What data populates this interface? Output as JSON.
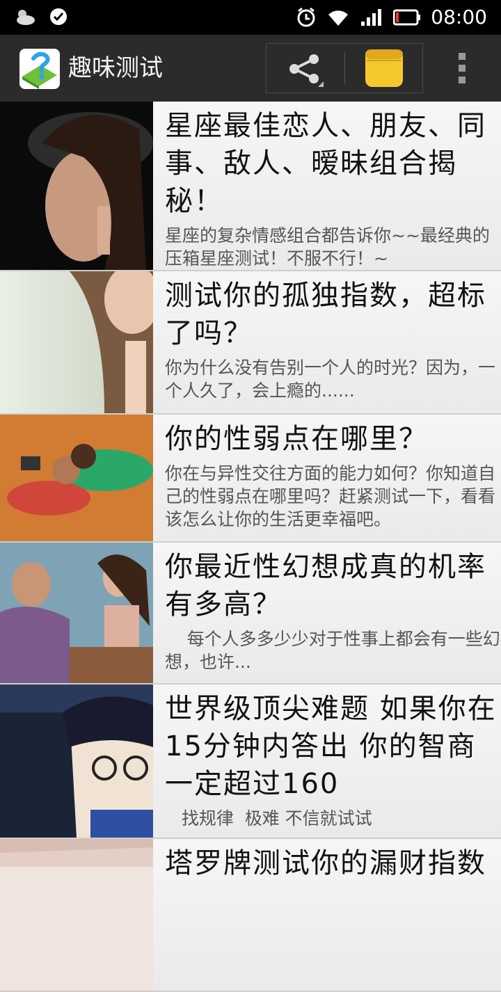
{
  "status_bar": {
    "time": "08:00",
    "icons": [
      "weather-cloud-icon",
      "check-circle-icon",
      "alarm-icon",
      "wifi-icon",
      "signal-icon",
      "battery-icon"
    ]
  },
  "action_bar": {
    "title": "趣味测试",
    "actions": [
      "share-icon",
      "notes-icon",
      "overflow-menu-icon"
    ],
    "accent_colors": {
      "logo_green": "#6fbf3b",
      "logo_blue": "#2fa3e6",
      "notes_yellow": "#f5c82b"
    }
  },
  "list": {
    "items": [
      {
        "title": "星座最佳恋人、朋友、同事、敌人、暧昧组合揭秘！",
        "desc": "星座的复杂情感组合都告诉你~~最经典的压箱星座测试！不服不行！~"
      },
      {
        "title": "测试你的孤独指数，超标了吗？",
        "desc": "你为什么没有告别一个人的时光？因为，一个人久了，会上瘾的......"
      },
      {
        "title": "你的性弱点在哪里？",
        "desc": "你在与异性交往方面的能力如何？你知道自己的性弱点在哪里吗？赶紧测试一下，看看该怎么让你的生活更幸福吧。"
      },
      {
        "title": "你最近性幻想成真的机率有多高？",
        "desc": "    每个人多多少少对于性事上都会有一些幻想，也许..."
      },
      {
        "title": "世界级顶尖难题 如果你在15分钟内答出  你的智商一定超过160",
        "desc": "   找规律  极难 不信就试试"
      },
      {
        "title": "塔罗牌测试你的漏财指数",
        "desc": ""
      }
    ]
  }
}
